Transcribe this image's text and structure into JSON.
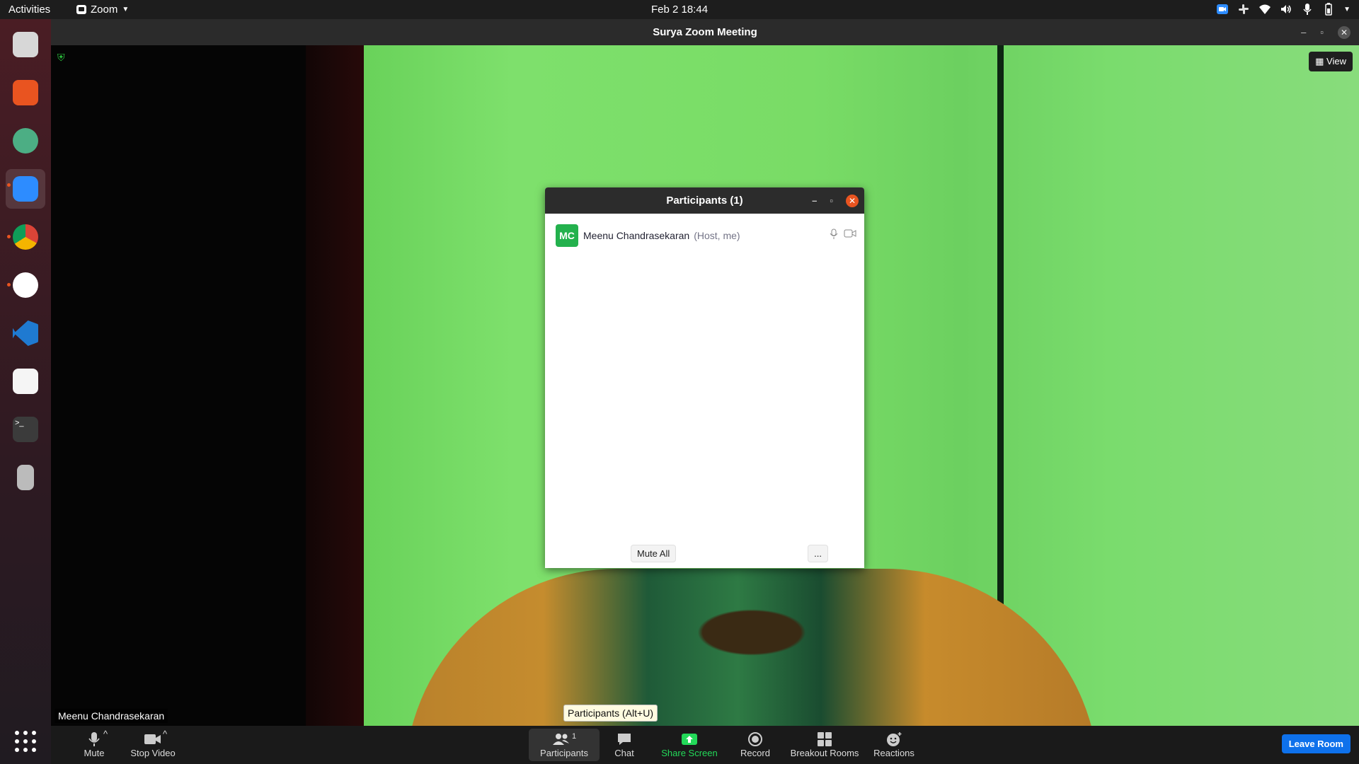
{
  "topbar": {
    "activities": "Activities",
    "app_name": "Zoom",
    "clock": "Feb 2  18:44"
  },
  "dock": {
    "items": [
      {
        "name": "files"
      },
      {
        "name": "software"
      },
      {
        "name": "atom"
      },
      {
        "name": "zoom"
      },
      {
        "name": "chrome"
      },
      {
        "name": "slack"
      },
      {
        "name": "vscode"
      },
      {
        "name": "text-editor"
      },
      {
        "name": "terminal"
      },
      {
        "name": "device"
      }
    ]
  },
  "window": {
    "title": "Surya  Zoom Meeting"
  },
  "video": {
    "view_label": "View",
    "participant_name": "Meenu Chandrasekaran"
  },
  "participants_panel": {
    "title": "Participants (1)",
    "participant": {
      "initials": "MC",
      "name": "Meenu Chandrasekaran",
      "role": "(Host, me)"
    },
    "mute_all_label": "Mute All",
    "more_label": "..."
  },
  "toolbar": {
    "mute": "Mute",
    "stop_video": "Stop Video",
    "participants": "Participants",
    "participants_count": "1",
    "chat": "Chat",
    "share_screen": "Share Screen",
    "record": "Record",
    "breakout_rooms": "Breakout Rooms",
    "reactions": "Reactions",
    "leave_room": "Leave Room"
  },
  "tooltip": "Participants (Alt+U)",
  "colors": {
    "share_green": "#23d959",
    "leave_blue": "#0e71eb",
    "avatar_green": "#23b14d"
  }
}
